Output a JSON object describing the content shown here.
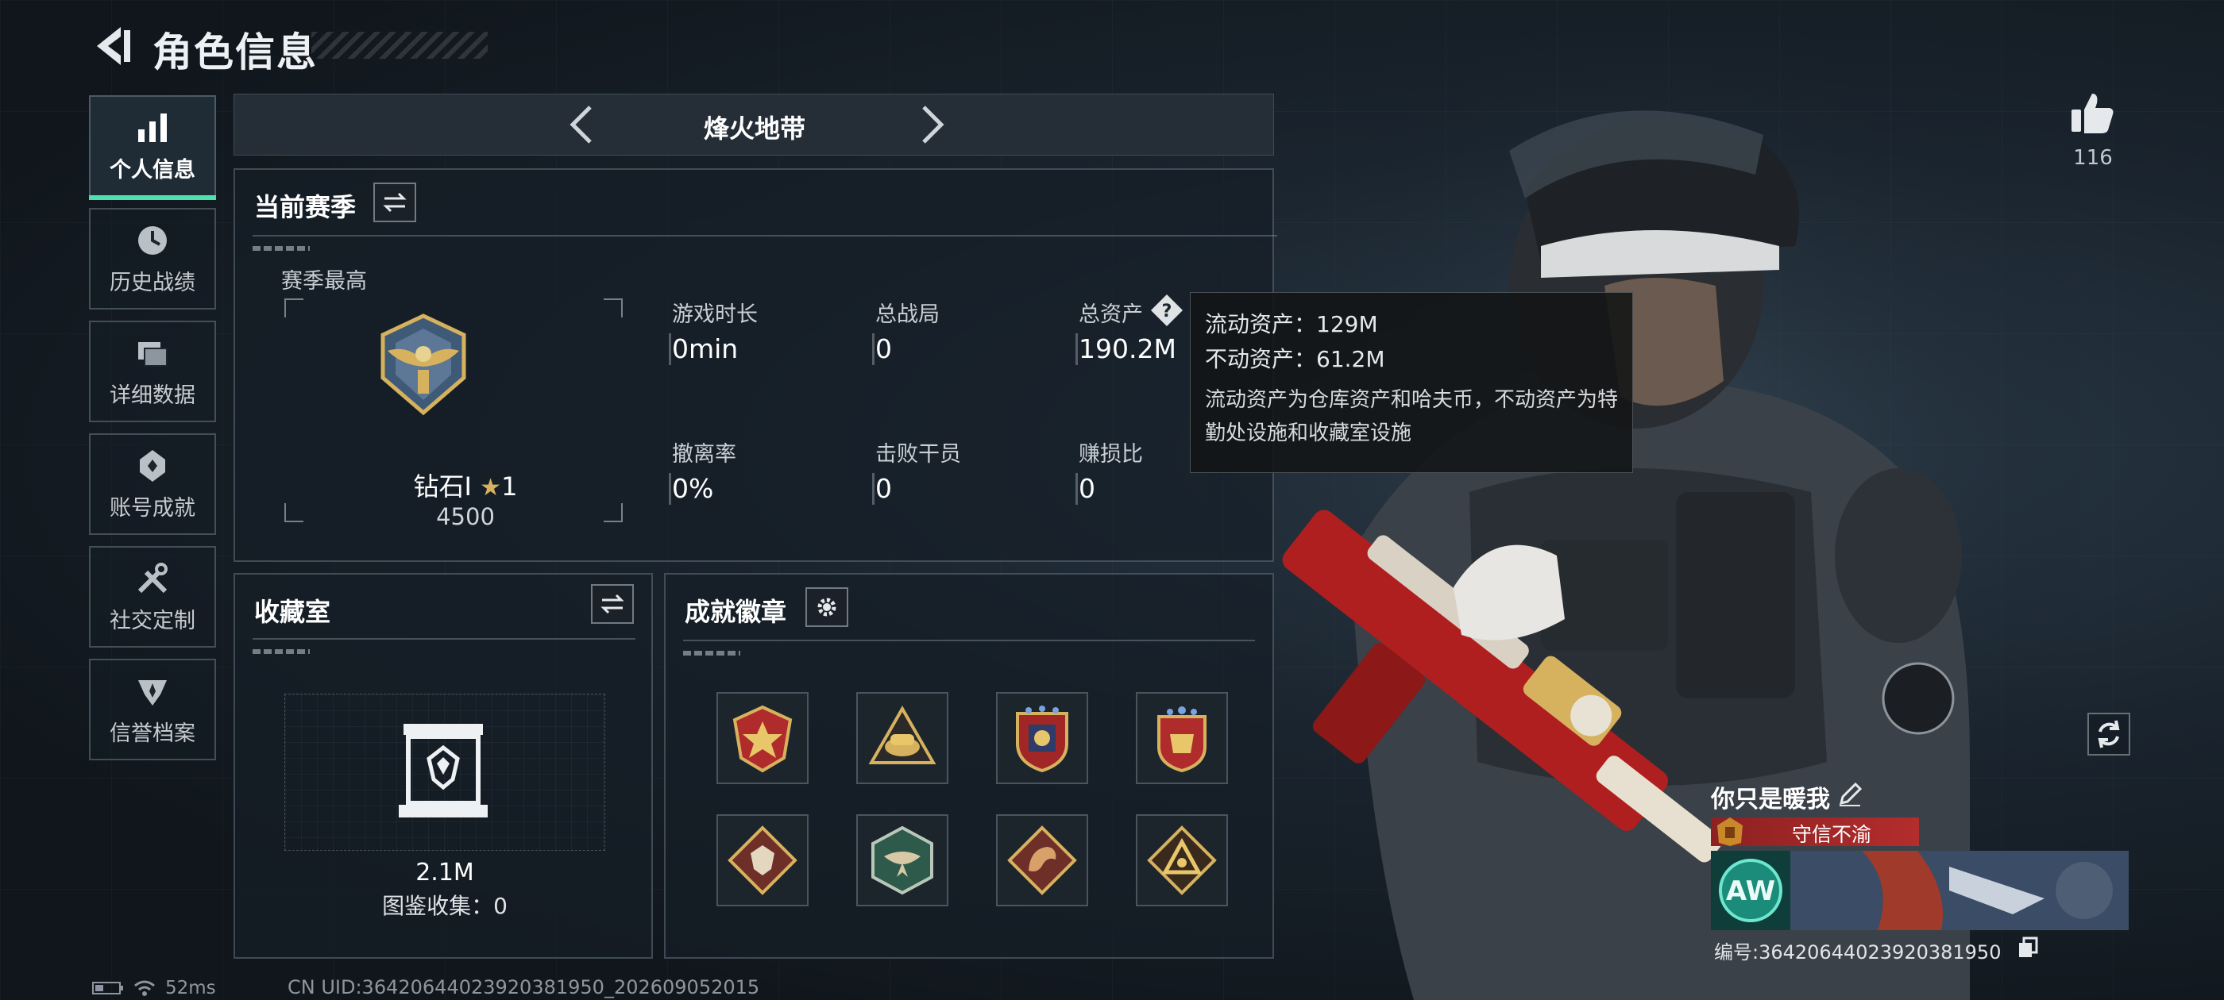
{
  "header": {
    "title": "角色信息"
  },
  "sidebar": {
    "items": [
      {
        "label": "个人信息",
        "icon": "bar-chart-icon",
        "active": true
      },
      {
        "label": "历史战绩",
        "icon": "history-clock-icon",
        "active": false
      },
      {
        "label": "详细数据",
        "icon": "cards-icon",
        "active": false
      },
      {
        "label": "账号成就",
        "icon": "achievement-icon",
        "active": false
      },
      {
        "label": "社交定制",
        "icon": "tools-icon",
        "active": false
      },
      {
        "label": "信誉档案",
        "icon": "shield-badge-icon",
        "active": false
      }
    ]
  },
  "mode": {
    "title": "烽火地带"
  },
  "season": {
    "title": "当前赛季",
    "best_label": "赛季最高",
    "rank_name": "钻石Ⅰ",
    "rank_stars": "1",
    "rank_points": "4500",
    "stats": [
      {
        "label": "游戏时长",
        "value": "0min"
      },
      {
        "label": "总战局",
        "value": "0"
      },
      {
        "label": "总资产",
        "value": "190.2M"
      },
      {
        "label": "撤离率",
        "value": "0%"
      },
      {
        "label": "击败干员",
        "value": "0"
      },
      {
        "label": "赚损比",
        "value": "0"
      }
    ]
  },
  "tooltip": {
    "liquid": "流动资产：129M",
    "fixed": "不动资产：61.2M",
    "desc": "流动资产为仓库资产和哈夫币，不动资产为特勤处设施和收藏室设施"
  },
  "collection": {
    "title": "收藏室",
    "value": "2.1M",
    "catalog": "图鉴收集：0"
  },
  "badges": {
    "title": "成就徽章",
    "items": [
      "star-shield-badge",
      "triangle-hat-badge",
      "crest-badge",
      "crown-shield-badge",
      "diamond-beast-badge",
      "hexagon-eagle-badge",
      "diamond-dragon-badge",
      "diamond-triangle-badge"
    ]
  },
  "likes": {
    "count": "116"
  },
  "player": {
    "name": "你只是暖我",
    "title_badge": "守信不渝",
    "id": "编号:3642064402392038195​0"
  },
  "status": {
    "ping": "52ms",
    "uid": "CN UID:36420644023920381950_202609052015"
  },
  "colors": {
    "accent": "#4fe0b0",
    "title_red": "#b32d2d",
    "gold": "#d6b25e"
  }
}
